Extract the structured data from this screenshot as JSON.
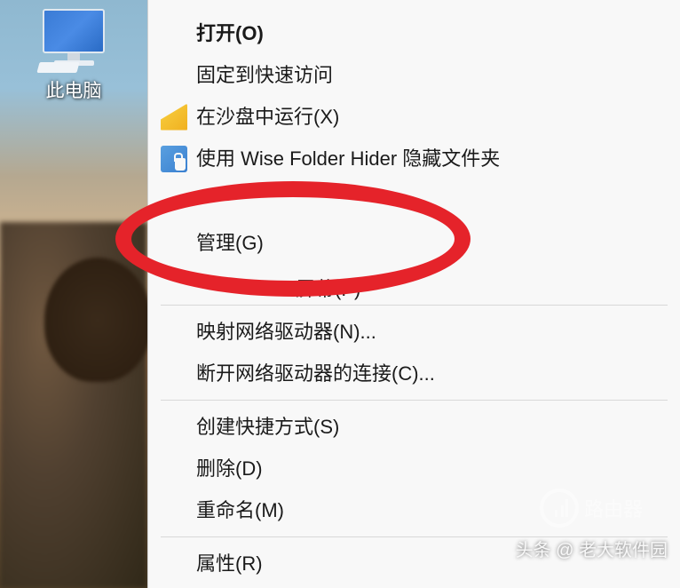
{
  "desktop": {
    "icon_label": "此电脑"
  },
  "context_menu": {
    "open": "打开(O)",
    "pin_quick_access": "固定到快速访问",
    "sandbox_run": "在沙盘中运行(X)",
    "wise_hider": "使用 Wise Folder Hider 隐藏文件夹",
    "manage": "管理(G)",
    "partial_screen": "屏幕(P)",
    "map_drive": "映射网络驱动器(N)...",
    "disconnect_drive": "断开网络驱动器的连接(C)...",
    "create_shortcut": "创建快捷方式(S)",
    "delete": "删除(D)",
    "rename": "重命名(M)",
    "properties": "属性(R)"
  },
  "watermark": {
    "logo_text": "路由器",
    "credit_text": "头条 @ 老大软件园"
  }
}
